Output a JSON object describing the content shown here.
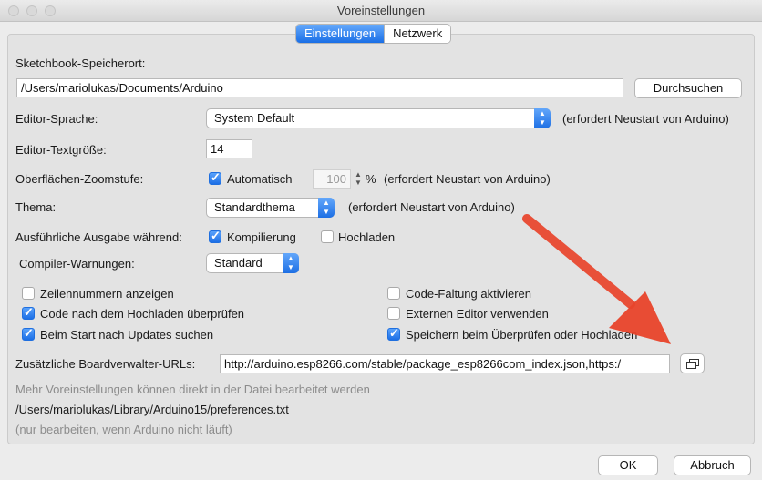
{
  "window": {
    "title": "Voreinstellungen"
  },
  "tabs": [
    {
      "label": "Einstellungen",
      "active": true
    },
    {
      "label": "Netzwerk",
      "active": false
    }
  ],
  "sketchbook": {
    "label": "Sketchbook-Speicherort:",
    "path": "/Users/mariolukas/Documents/Arduino",
    "browse_button": "Durchsuchen"
  },
  "editor_language": {
    "label": "Editor-Sprache:",
    "value": "System Default",
    "note": "(erfordert Neustart von Arduino)"
  },
  "editor_font_size": {
    "label": "Editor-Textgröße:",
    "value": "14"
  },
  "zoom": {
    "label": "Oberflächen-Zoomstufe:",
    "auto_label": "Automatisch",
    "auto_checked": true,
    "value": "100",
    "unit": "%",
    "note": "(erfordert Neustart von Arduino)"
  },
  "theme": {
    "label": "Thema:",
    "value": "Standardthema",
    "note": "(erfordert Neustart von Arduino)"
  },
  "verbose": {
    "label": "Ausführliche Ausgabe während:",
    "compile_label": "Kompilierung",
    "compile_checked": true,
    "upload_label": "Hochladen",
    "upload_checked": false
  },
  "warnings": {
    "label": "Compiler-Warnungen:",
    "value": "Standard"
  },
  "options_left": [
    {
      "label": "Zeilennummern anzeigen",
      "checked": false
    },
    {
      "label": "Code nach dem Hochladen überprüfen",
      "checked": true
    },
    {
      "label": "Beim Start nach Updates suchen",
      "checked": true
    }
  ],
  "options_right": [
    {
      "label": "Code-Faltung aktivieren",
      "checked": false
    },
    {
      "label": "Externen Editor verwenden",
      "checked": false
    },
    {
      "label": "Speichern beim Überprüfen oder Hochladen",
      "checked": true
    }
  ],
  "board_urls": {
    "label": "Zusätzliche Boardverwalter-URLs:",
    "value": "http://arduino.esp8266.com/stable/package_esp8266com_index.json,https:/"
  },
  "footer_info": {
    "line1": "Mehr Voreinstellungen können direkt in der Datei bearbeitet werden",
    "path": "/Users/mariolukas/Library/Arduino15/preferences.txt",
    "line3": "(nur bearbeiten, wenn Arduino nicht läuft)"
  },
  "buttons": {
    "ok": "OK",
    "cancel": "Abbruch"
  },
  "colors": {
    "accent": "#1a6fe6",
    "annotation_arrow": "#e8432a"
  }
}
